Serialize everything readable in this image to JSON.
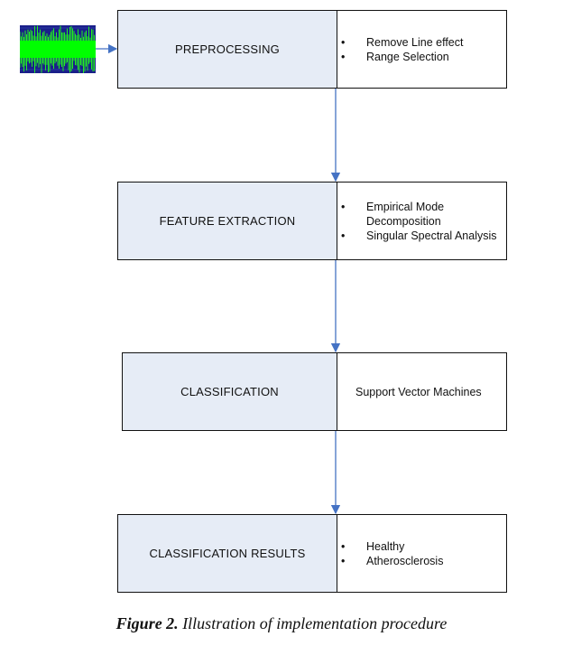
{
  "figure": {
    "caption_label": "Figure 2.",
    "caption_text": " Illustration of implementation procedure"
  },
  "input": {
    "icon": "waveform-signal-icon",
    "colors": {
      "background": "#1a237e",
      "signal": "#00ff00"
    }
  },
  "colors": {
    "step_fill": "#e6ecf6",
    "border": "#111111",
    "arrow": "#4472c4"
  },
  "steps": [
    {
      "title": "PREPROCESSING",
      "details": [
        "Remove Line effect",
        "Range Selection"
      ],
      "bulleted": true
    },
    {
      "title": "FEATURE EXTRACTION",
      "details": [
        "Empirical Mode Decomposition",
        "Singular Spectral Analysis"
      ],
      "bulleted": true
    },
    {
      "title": "CLASSIFICATION",
      "details": [
        "Support Vector Machines"
      ],
      "bulleted": false
    },
    {
      "title": "CLASSIFICATION RESULTS",
      "details": [
        "Healthy",
        "Atherosclerosis"
      ],
      "bulleted": true
    }
  ]
}
